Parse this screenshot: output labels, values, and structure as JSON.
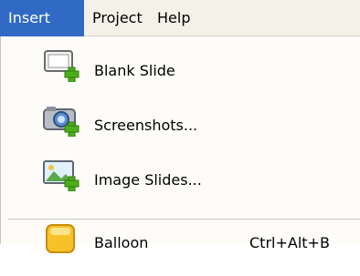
{
  "menubar": {
    "items": [
      {
        "label": "Insert"
      },
      {
        "label": "Project"
      },
      {
        "label": "Help"
      }
    ]
  },
  "menu": {
    "items": [
      {
        "label": "Blank Slide",
        "icon": "blank-slide-add-icon"
      },
      {
        "label": "Screenshots...",
        "icon": "camera-add-icon"
      },
      {
        "label": "Image Slides...",
        "icon": "image-add-icon"
      },
      {
        "label": "Balloon",
        "shortcut": "Ctrl+Alt+B",
        "icon": "balloon-icon"
      }
    ]
  },
  "colors": {
    "highlight": "#316ac5",
    "menubar_bg": "#f4f2e8",
    "menu_bg": "#fdfcf9",
    "plus_green": "#4caf1a"
  }
}
